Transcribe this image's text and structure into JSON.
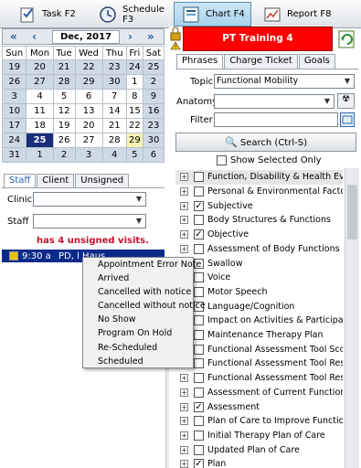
{
  "nav": {
    "tabs": [
      {
        "label": "Task F2"
      },
      {
        "label": "Schedule F3"
      },
      {
        "label": "Chart F4"
      },
      {
        "label": "Report F8"
      }
    ],
    "active": "Chart F4"
  },
  "calendar": {
    "month_label": "Dec, 2017",
    "weekdays": [
      "Sun",
      "Mon",
      "Tue",
      "Wed",
      "Thu",
      "Fri",
      "Sat"
    ],
    "weeks": [
      [
        "19",
        "20",
        "21",
        "22",
        "23",
        "24",
        "25"
      ],
      [
        "26",
        "27",
        "28",
        "29",
        "30",
        "1",
        "2"
      ],
      [
        "3",
        "4",
        "5",
        "6",
        "7",
        "8",
        "9"
      ],
      [
        "10",
        "11",
        "12",
        "13",
        "14",
        "15",
        "16"
      ],
      [
        "17",
        "18",
        "19",
        "20",
        "21",
        "22",
        "23"
      ],
      [
        "24",
        "25",
        "26",
        "27",
        "28",
        "29",
        "30"
      ],
      [
        "31",
        "1",
        "2",
        "3",
        "4",
        "5",
        "6"
      ]
    ],
    "selected_day": "25",
    "today_day": "29"
  },
  "staff_tabs": [
    "Staff",
    "Client",
    "Unsigned"
  ],
  "clinic_label": "Clinic",
  "staff_label": "Staff",
  "clinic_value": "",
  "staff_value": "",
  "unsigned_text": "has 4 unsigned visits.",
  "visit": {
    "time": "9:30 a",
    "text": "PD, l Haus"
  },
  "context_menu": [
    "Appointment Error Note",
    "Arrived",
    "Cancelled with notice",
    "Cancelled without notice",
    "No Show",
    "Program On Hold",
    "Re-Scheduled",
    "Scheduled"
  ],
  "patient_bar": "PT Training 4",
  "right_tabs": [
    "Phrases",
    "Charge Ticket",
    "Goals"
  ],
  "topic_label": "Topic",
  "topic_value": "Functional Mobility",
  "anatomy_label": "Anatomy",
  "anatomy_value": "",
  "filter_label": "Filter",
  "filter_value": "",
  "search_button": "Search (Ctrl-S)",
  "show_selected_label": "Show Selected Only",
  "tree": [
    {
      "label": "Function, Disability & Health Evalu",
      "checked": false
    },
    {
      "label": "Personal & Environmental Factors",
      "checked": false
    },
    {
      "label": "Subjective",
      "checked": true
    },
    {
      "label": "Body Structures & Functions",
      "checked": false
    },
    {
      "label": "Objective",
      "checked": true
    },
    {
      "label": "Assessment of Body Functions",
      "checked": false
    },
    {
      "label": "Swallow",
      "checked": false
    },
    {
      "label": "Voice",
      "checked": false
    },
    {
      "label": "Motor Speech",
      "checked": false
    },
    {
      "label": "Language/Cognition",
      "checked": false
    },
    {
      "label": "Impact on Activities & Participation",
      "checked": false
    },
    {
      "label": "Maintenance Therapy Plan",
      "checked": false
    },
    {
      "label": "Functional Assessment Tool Scor",
      "checked": false
    },
    {
      "label": "Functional Assessment Tool Resp",
      "checked": false
    },
    {
      "label": "Functional Assessment Tool Resp",
      "checked": false
    },
    {
      "label": "Assessment of Current Function,",
      "checked": false
    },
    {
      "label": "Assessment",
      "checked": true
    },
    {
      "label": "Plan of Care to Improve Function",
      "checked": false
    },
    {
      "label": "Initial Therapy Plan of Care",
      "checked": false
    },
    {
      "label": "Updated  Plan of Care",
      "checked": false
    },
    {
      "label": "Plan",
      "checked": true
    }
  ],
  "colors": {
    "patient_bar": "#ff0000",
    "selected_day": "#1a2f7a",
    "visit_row": "#0a2a8a",
    "unsigned_text": "#c8102e"
  }
}
